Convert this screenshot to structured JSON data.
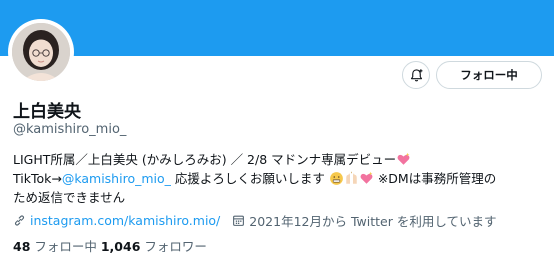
{
  "profile": {
    "display_name": "上白美央",
    "handle": "@kamishiro_mio_",
    "follow_button_label": "フォロー中",
    "notify_icon": "bell-plus-icon"
  },
  "bio": {
    "line1": "LIGHT所属／上白美央 (かみしろみお) ／ 2/8 マドンナ専属デビュー",
    "line2_prefix": "TikTok→",
    "line2_link": "@kamishiro_mio_",
    "line2_text": " 応援よろしくお願いします",
    "line2_suffix": " ※DMは事務所管理の",
    "line3": "ため返信できません"
  },
  "meta": {
    "website": "instagram.com/kamishiro.mio/",
    "joined": "2021年12月から Twitter を利用しています"
  },
  "stats": {
    "following_count": "48",
    "following_label": " フォロー中 ",
    "followers_count": "1,046",
    "followers_label": " フォロワー"
  },
  "colors": {
    "banner": "#1d9bf0",
    "link": "#1d9bf0",
    "secondary_text": "#536471"
  }
}
